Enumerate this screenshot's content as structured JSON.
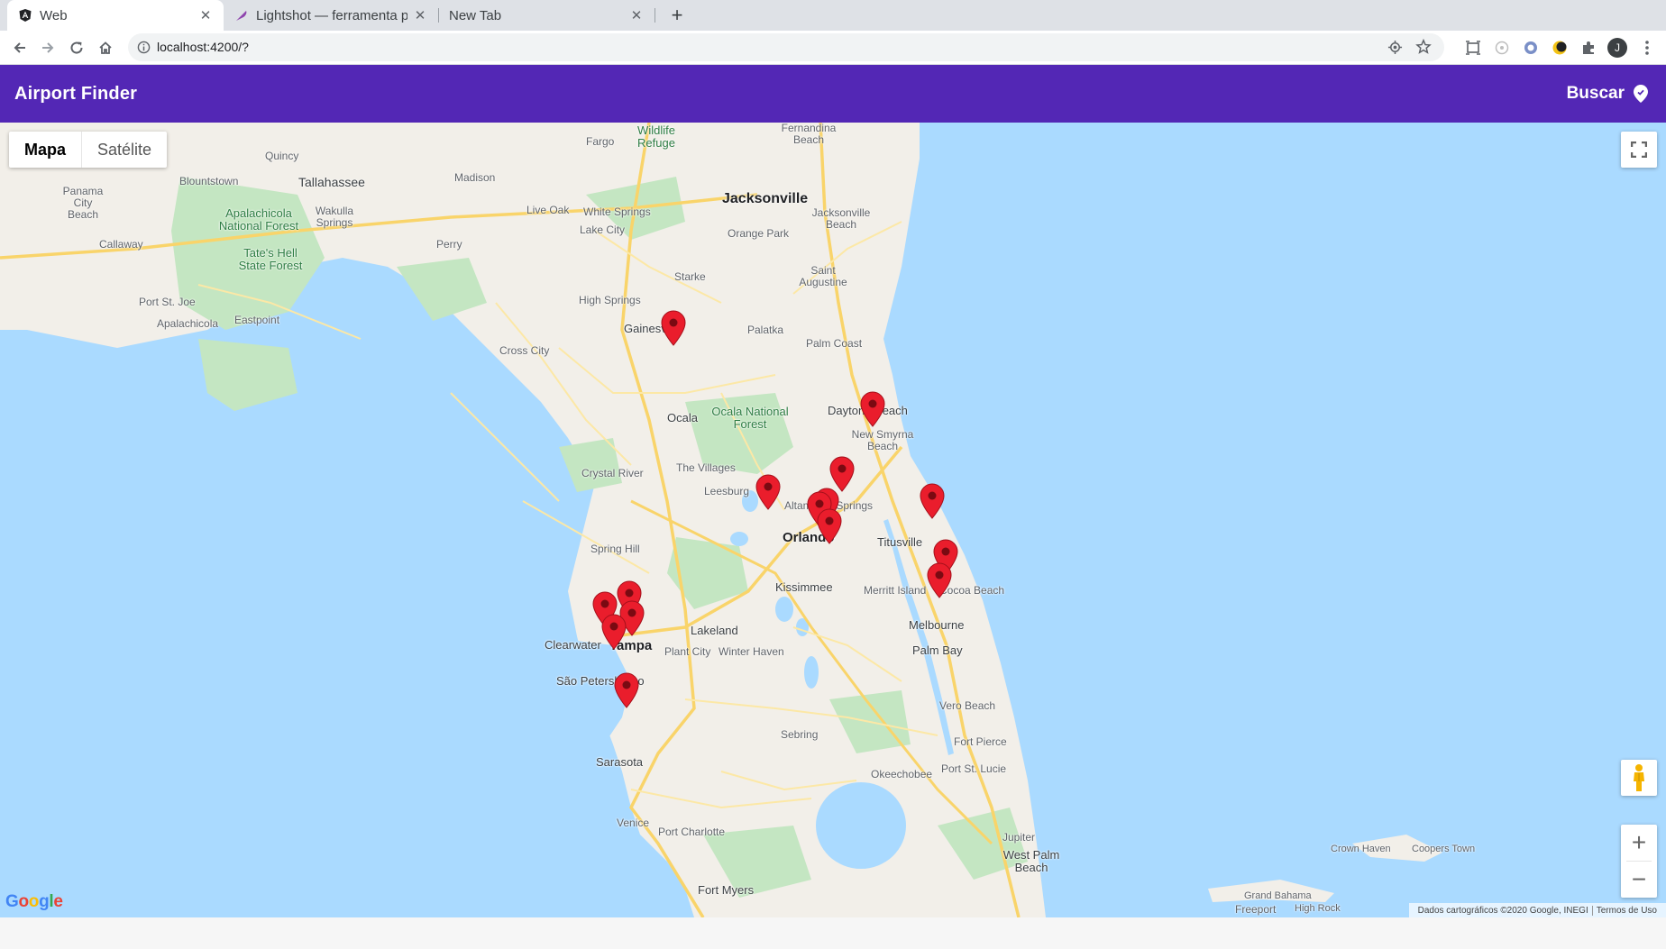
{
  "browser": {
    "tabs": [
      {
        "title": "Web",
        "active": true,
        "icon": "angular-icon"
      },
      {
        "title": "Lightshot — ferramenta p",
        "active": false,
        "icon": "feather-icon"
      },
      {
        "title": "New Tab",
        "active": false,
        "icon": ""
      }
    ],
    "url": "localhost:4200/?"
  },
  "appbar": {
    "title": "Airport Finder",
    "search_label": "Buscar"
  },
  "map": {
    "type_buttons": {
      "map": "Mapa",
      "satellite": "Satélite"
    },
    "zoom_in": "+",
    "zoom_out": "−",
    "logo": "Google",
    "attribution": "Dados cartográficos ©2020 Google, INEGI",
    "terms": "Termos de Uso",
    "labels": {
      "jacksonville": "Jacksonville",
      "tallahassee": "Tallahassee",
      "gainesville": "Gainesville",
      "orlando": "Orlando",
      "tampa": "Tampa",
      "daytona": "Daytona Beach",
      "st_petersburg": "São Petersburgo",
      "clearwater": "Clearwater",
      "sarasota": "Sarasota",
      "melbourne": "Melbourne",
      "palm_bay": "Palm Bay",
      "titusville": "Titusville",
      "kissimmee": "Kissimmee",
      "lakeland": "Lakeland",
      "ocala": "Ocala",
      "palatka": "Palatka",
      "palm_coast": "Palm Coast",
      "saint_augustine": "Saint Augustine",
      "new_smyrna": "New Smyrna Beach",
      "the_villages": "The Villages",
      "leesburg": "Leesburg",
      "altamonte": "Altamonte Springs",
      "spring_hill": "Spring Hill",
      "crystal_river": "Crystal River",
      "sebring": "Sebring",
      "vero_beach": "Vero Beach",
      "fort_pierce": "Fort Pierce",
      "port_st_lucie": "Port St. Lucie",
      "okeechobee": "Okeechobee",
      "jupiter": "Jupiter",
      "west_palm": "West Palm Beach",
      "fort_myers": "Fort Myers",
      "port_charlotte": "Port Charlotte",
      "venice": "Venice",
      "plant_city": "Plant City",
      "winter_haven": "Winter Haven",
      "merritt_island": "Merritt Island",
      "cocoa_beach": "Cocoa Beach",
      "lake_city": "Lake City",
      "live_oak": "Live Oak",
      "perry": "Perry",
      "madison": "Madison",
      "quincy": "Quincy",
      "starke": "Starke",
      "orange_park": "Orange Park",
      "jacksonville_beach": "Jacksonville Beach",
      "fernandina": "Fernandina Beach",
      "cross_city": "Cross City",
      "high_springs": "High Springs",
      "apalachicola_forest": "Apalachicola National Forest",
      "ocala_forest": "Ocala National Forest",
      "tates_hell": "Tate's Hell State Forest",
      "wildlife_refuge": "Wildlife Refuge",
      "freeport": "Freeport",
      "grand_bahama": "Grand Bahama",
      "high_rock": "High Rock",
      "crown_haven": "Crown Haven",
      "coopers_town": "Coopers Town",
      "panama_city": "Panama City Beach",
      "callaway": "Callaway",
      "port_st_joe": "Port St. Joe",
      "apalachicola": "Apalachicola",
      "eastpoint": "Eastpoint",
      "blountstown": "Blountstown",
      "wakulla": "Wakulla Springs",
      "white_springs": "White Springs",
      "fargo": "Fargo"
    },
    "airport_markers": [
      "gainesville",
      "daytona",
      "sanford",
      "leesburg",
      "orlando-exec",
      "orlando-mco",
      "orlando-kissimmee",
      "titusville",
      "cocoa",
      "melbourne",
      "tampa-1",
      "tampa-2",
      "clearwater",
      "st-pete",
      "sarasota"
    ]
  },
  "colors": {
    "appbar": "#5327b5",
    "water": "#aadaff",
    "land": "#f2efe9",
    "marker": "#ea1d2c"
  }
}
